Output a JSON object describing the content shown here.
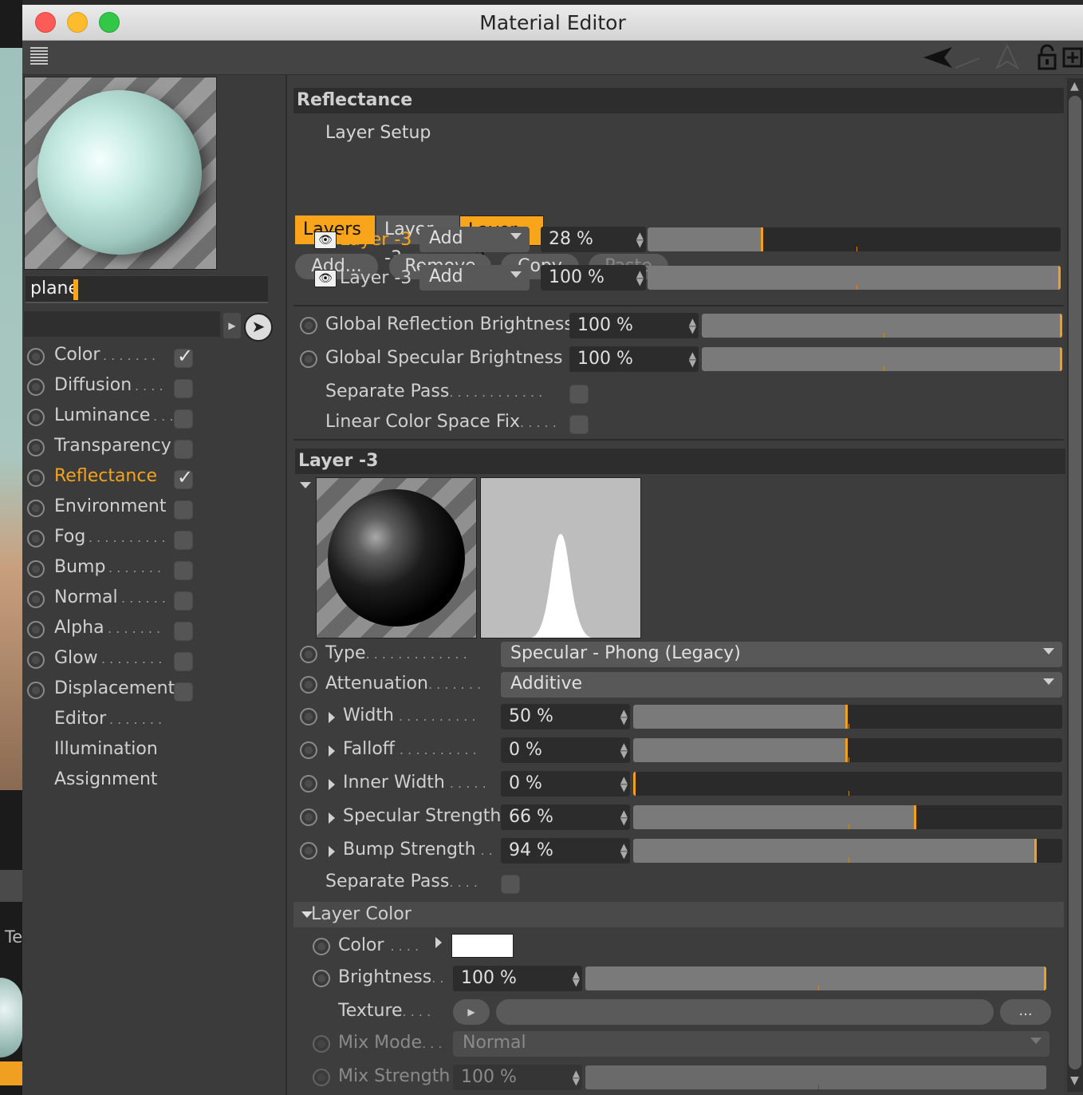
{
  "window": {
    "title": "Material Editor"
  },
  "host": {
    "partial_label": "Te"
  },
  "material": {
    "name": "plane",
    "channels": [
      {
        "label": "Color",
        "dots": "  . . . . . . .",
        "checkbox": true,
        "checked": true,
        "active": false
      },
      {
        "label": "Diffusion",
        "dots": "  . . . .",
        "checkbox": true,
        "checked": false,
        "active": false
      },
      {
        "label": "Luminance",
        "dots": ". . .",
        "checkbox": true,
        "checked": false,
        "active": false
      },
      {
        "label": "Transparency",
        "dots": "",
        "checkbox": true,
        "checked": false,
        "active": false
      },
      {
        "label": "Reflectance",
        "dots": "",
        "checkbox": true,
        "checked": true,
        "active": true
      },
      {
        "label": "Environment",
        "dots": "",
        "checkbox": true,
        "checked": false,
        "active": false
      },
      {
        "label": "Fog",
        "dots": " . . . . . . . . . .",
        "checkbox": true,
        "checked": false,
        "active": false
      },
      {
        "label": "Bump",
        "dots": "  . . . . . . .",
        "checkbox": true,
        "checked": false,
        "active": false
      },
      {
        "label": "Normal",
        "dots": " . . . . . .",
        "checkbox": true,
        "checked": false,
        "active": false
      },
      {
        "label": "Alpha",
        "dots": "  . . . . . . .",
        "checkbox": true,
        "checked": false,
        "active": false
      },
      {
        "label": "Glow",
        "dots": " . . . . . . . .",
        "checkbox": true,
        "checked": false,
        "active": false
      },
      {
        "label": "Displacement",
        "dots": "",
        "checkbox": true,
        "checked": false,
        "active": false
      },
      {
        "label": "Editor",
        "dots": "  . . . . . . .",
        "checkbox": false,
        "checked": false,
        "active": false
      },
      {
        "label": "Illumination",
        "dots": "",
        "checkbox": false,
        "checked": false,
        "active": false
      },
      {
        "label": "Assignment",
        "dots": "",
        "checkbox": false,
        "checked": false,
        "active": false
      }
    ]
  },
  "reflectance": {
    "header": "Reflectance",
    "layer_setup": "Layer Setup",
    "tabs": [
      "Layers",
      "Layer -3",
      "Layer -3"
    ],
    "buttons": {
      "add": "Add...",
      "remove": "Remove",
      "copy": "Copy",
      "paste": "Paste"
    },
    "layers": [
      {
        "name": "Layer -3",
        "mode": "Add",
        "value": "28 %",
        "fraction": 0.28,
        "active": true
      },
      {
        "name": "Layer -3",
        "mode": "Add",
        "value": "100 %",
        "fraction": 1.0,
        "active": false
      }
    ],
    "global_reflection_brightness": {
      "label": "Global Reflection Brightness",
      "value": "100 %",
      "fraction": 1.0
    },
    "global_specular_brightness": {
      "label": "Global Specular Brightness",
      "value": "100 %",
      "fraction": 1.0
    },
    "separate_pass": "Separate Pass",
    "separate_pass_dots": ". . . . . . . . . . . .",
    "linear_fix": "Linear Color Space Fix",
    "linear_fix_dots": ". . . . .",
    "layer_section": {
      "header": "Layer -3",
      "type_label": "Type",
      "type_dots": ". . . . . . . . . . . . .",
      "type_value": "Specular - Phong (Legacy)",
      "attenuation_label": "Attenuation",
      "attenuation_dots": ". . . . . . .",
      "attenuation_value": "Additive",
      "params": [
        {
          "label": "Width",
          "dots": ". . . . . . . . . .",
          "value": "50 %",
          "fraction": 0.5
        },
        {
          "label": "Falloff",
          "dots": ". . . . . . . . . .",
          "value": "0 %",
          "fraction": 0.5
        },
        {
          "label": "Inner Width",
          "dots": ". . . . .",
          "value": "0 %",
          "fraction": 0.0
        },
        {
          "label": "Specular Strength",
          "dots": "",
          "value": "66 %",
          "fraction": 0.66
        },
        {
          "label": "Bump Strength",
          "dots": ". .",
          "value": "94 %",
          "fraction": 0.94
        }
      ],
      "separate_pass": "Separate Pass",
      "separate_pass_dots": ". . . ."
    },
    "layer_color": {
      "header": "Layer Color",
      "color_label": "Color",
      "color_dots": ". . . .",
      "color_value": "#ffffff",
      "brightness_label": "Brightness",
      "brightness_dots": ". .",
      "brightness_value": "100 %",
      "brightness_fraction": 1.0,
      "texture_label": "Texture",
      "texture_dots": ". . . .",
      "texture_more": "...",
      "mix_mode_label": "Mix Mode",
      "mix_mode_dots": ". . .",
      "mix_mode_value": "Normal",
      "mix_strength_label": "Mix Strength",
      "mix_strength_value": "100 %",
      "mix_strength_fraction": 1.0
    }
  },
  "colors": {
    "accent": "#f8a51c",
    "panel": "#3d3d3d",
    "field": "#2c2c2c"
  }
}
